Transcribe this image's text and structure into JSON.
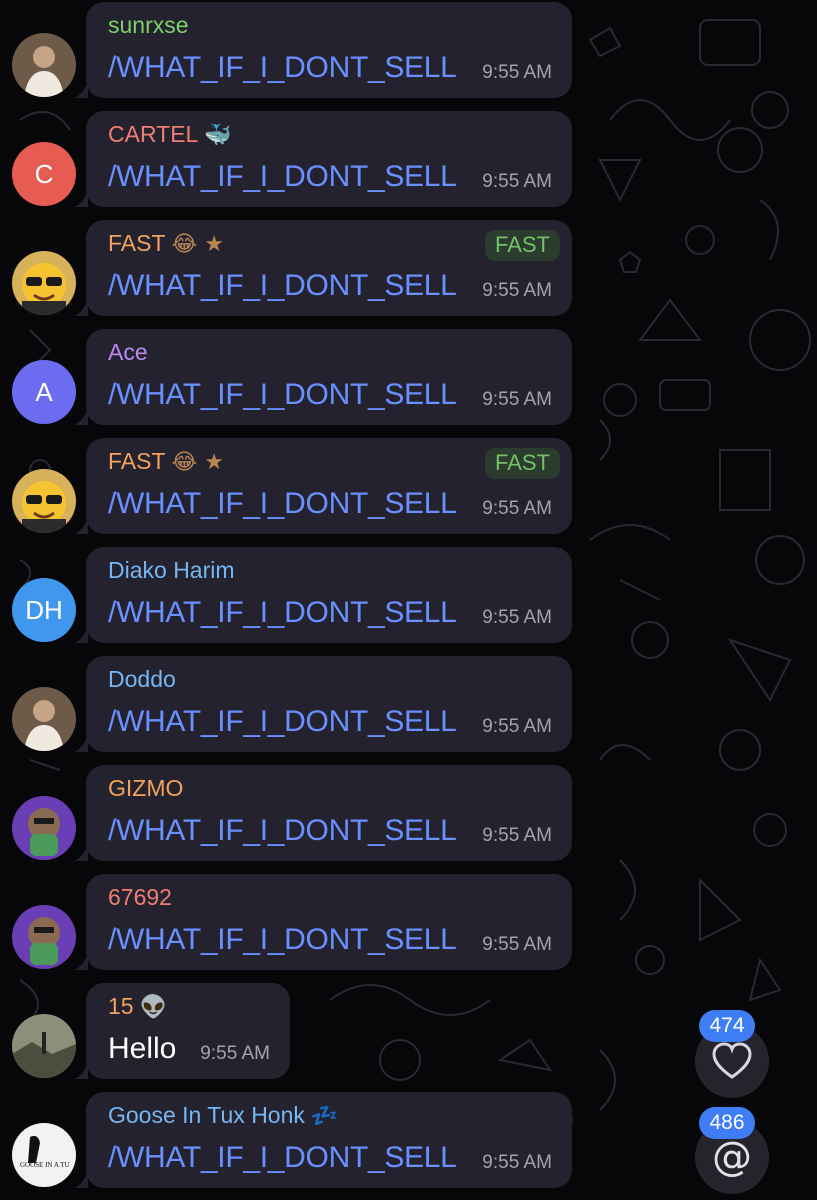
{
  "messages": [
    {
      "sender": "sunrxse",
      "name_color": "#7fd069",
      "emoji": "",
      "badge": "",
      "text": "/WHAT_IF_I_DONT_SELL",
      "time": "9:55 AM",
      "avatar": {
        "type": "photo",
        "initials": "",
        "icon": "person-photo-icon"
      }
    },
    {
      "sender": "CARTEL",
      "name_color": "#ef7f73",
      "emoji": "🐳",
      "badge": "",
      "text": "/WHAT_IF_I_DONT_SELL",
      "time": "9:55 AM",
      "avatar": {
        "type": "initials",
        "initials": "C",
        "color": "#e65b52"
      }
    },
    {
      "sender": "FAST",
      "name_color": "#f2a25c",
      "emoji": "😂 ★",
      "badge": "FAST",
      "text": "/WHAT_IF_I_DONT_SELL",
      "time": "9:55 AM",
      "avatar": {
        "type": "photo",
        "initials": "",
        "icon": "sunglasses-emoji-icon"
      }
    },
    {
      "sender": "Ace",
      "name_color": "#b98bf2",
      "emoji": "",
      "badge": "",
      "text": "/WHAT_IF_I_DONT_SELL",
      "time": "9:55 AM",
      "avatar": {
        "type": "initials",
        "initials": "A",
        "color": "#6c6cf0"
      }
    },
    {
      "sender": "FAST",
      "name_color": "#f2a25c",
      "emoji": "😂 ★",
      "badge": "FAST",
      "text": "/WHAT_IF_I_DONT_SELL",
      "time": "9:55 AM",
      "avatar": {
        "type": "photo",
        "initials": "",
        "icon": "sunglasses-emoji-icon"
      }
    },
    {
      "sender": "Diako Harim",
      "name_color": "#76b7f2",
      "emoji": "",
      "badge": "",
      "text": "/WHAT_IF_I_DONT_SELL",
      "time": "9:55 AM",
      "avatar": {
        "type": "initials",
        "initials": "DH",
        "color": "#3f98ee"
      }
    },
    {
      "sender": "Doddo",
      "name_color": "#76b7f2",
      "emoji": "",
      "badge": "",
      "text": "/WHAT_IF_I_DONT_SELL",
      "time": "9:55 AM",
      "avatar": {
        "type": "photo",
        "initials": "",
        "icon": "person-photo-icon"
      }
    },
    {
      "sender": "GIZMO",
      "name_color": "#f2a25c",
      "emoji": "",
      "badge": "",
      "text": "/WHAT_IF_I_DONT_SELL",
      "time": "9:55 AM",
      "avatar": {
        "type": "photo",
        "initials": "",
        "icon": "cartoon-character-icon"
      }
    },
    {
      "sender": "67692",
      "name_color": "#ef7f73",
      "emoji": "",
      "badge": "",
      "text": "/WHAT_IF_I_DONT_SELL",
      "time": "9:55 AM",
      "avatar": {
        "type": "photo",
        "initials": "",
        "icon": "cartoon-character-icon"
      }
    },
    {
      "sender": "15",
      "name_color": "#f2a25c",
      "emoji": "👽",
      "badge": "",
      "text": "Hello",
      "time": "9:55 AM",
      "avatar": {
        "type": "photo",
        "initials": "",
        "icon": "landscape-photo-icon"
      }
    },
    {
      "sender": "Goose In Tux Honk",
      "name_color": "#76b7f2",
      "emoji": "💤",
      "badge": "",
      "text": "/WHAT_IF_I_DONT_SELL",
      "time": "9:55 AM",
      "avatar": {
        "type": "photo",
        "initials": "",
        "icon": "goose-logo-icon"
      }
    }
  ],
  "reactions_button": {
    "count": "474",
    "icon": "heart-icon"
  },
  "mentions_button": {
    "count": "486",
    "icon": "at-sign-icon"
  },
  "colors": {
    "background": "#070709",
    "bubble": "#24222e",
    "command_link": "#6a8fff",
    "time": "#a4a2ad",
    "count_badge": "#3e7df3"
  }
}
